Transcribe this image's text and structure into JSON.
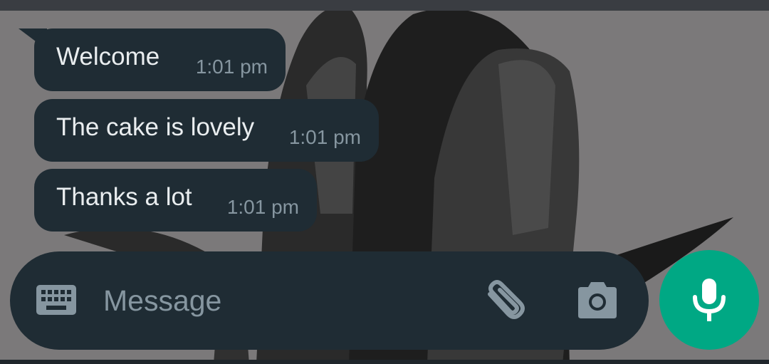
{
  "messages": [
    {
      "text": "Welcome",
      "time": "1:01 pm"
    },
    {
      "text": "The cake is lovely",
      "time": "1:01 pm"
    },
    {
      "text": "Thanks a lot",
      "time": "1:01 pm"
    }
  ],
  "composer": {
    "placeholder": "Message",
    "keyboard_icon": "keyboard-icon",
    "attach_icon": "paperclip-icon",
    "camera_icon": "camera-icon"
  },
  "mic_button": {
    "icon": "microphone-icon"
  },
  "colors": {
    "bubble": "#1f2c34",
    "text": "#e9edef",
    "muted": "#8696a0",
    "accent": "#00a884"
  }
}
